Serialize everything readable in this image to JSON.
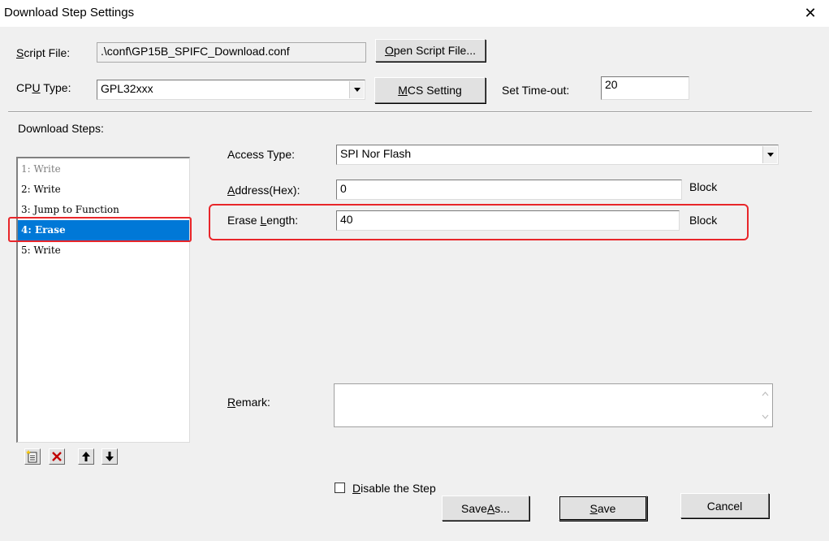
{
  "window": {
    "title": "Download Step Settings",
    "close_glyph": "✕"
  },
  "script_file": {
    "label_accel": "S",
    "label_rest": "cript File:",
    "value": ".\\conf\\GP15B_SPIFC_Download.conf",
    "open_button_accel": "O",
    "open_button_rest": "pen Script File..."
  },
  "cpu_type": {
    "label_pre": "CP",
    "label_accel": "U",
    "label_post": " Type:",
    "value": "GPL32xxx",
    "mcs_button_accel": "M",
    "mcs_button_rest": "CS Setting",
    "timeout_label": "Set Time-out:",
    "timeout_value": "20"
  },
  "steps": {
    "heading": "Download Steps:",
    "items": [
      {
        "label": "1: Write",
        "disabled": true,
        "selected": false
      },
      {
        "label": "2: Write",
        "disabled": false,
        "selected": false
      },
      {
        "label": "3: Jump to Function",
        "disabled": false,
        "selected": false
      },
      {
        "label": "4: Erase",
        "disabled": false,
        "selected": true
      },
      {
        "label": "5: Write",
        "disabled": false,
        "selected": false
      }
    ],
    "toolbar": {
      "add_icon": "new-step-icon",
      "delete_icon": "delete-x-icon",
      "up_icon": "arrow-up-icon",
      "down_icon": "arrow-down-icon",
      "delete_color": "#c00000"
    }
  },
  "detail": {
    "access_type_label": "Access Type:",
    "access_type_value": "SPI Nor Flash",
    "address_label_accel": "A",
    "address_label_rest": "ddress(Hex):",
    "address_value": "0",
    "address_unit": "Block",
    "erase_label_pre": "Erase ",
    "erase_label_accel": "L",
    "erase_label_rest": "ength:",
    "erase_value": "40",
    "erase_unit": "Block",
    "remark_label_accel": "R",
    "remark_label_rest": "emark:",
    "remark_value": ""
  },
  "footer": {
    "disable_accel": "D",
    "disable_rest": "isable the Step",
    "disable_checked": false,
    "save_as_pre": "Save ",
    "save_as_accel": "A",
    "save_as_rest": "s...",
    "save_accel": "S",
    "save_rest": "ave",
    "cancel_label": "Cancel"
  },
  "colors": {
    "highlight": "#e8262a",
    "selection": "#0078d7"
  }
}
